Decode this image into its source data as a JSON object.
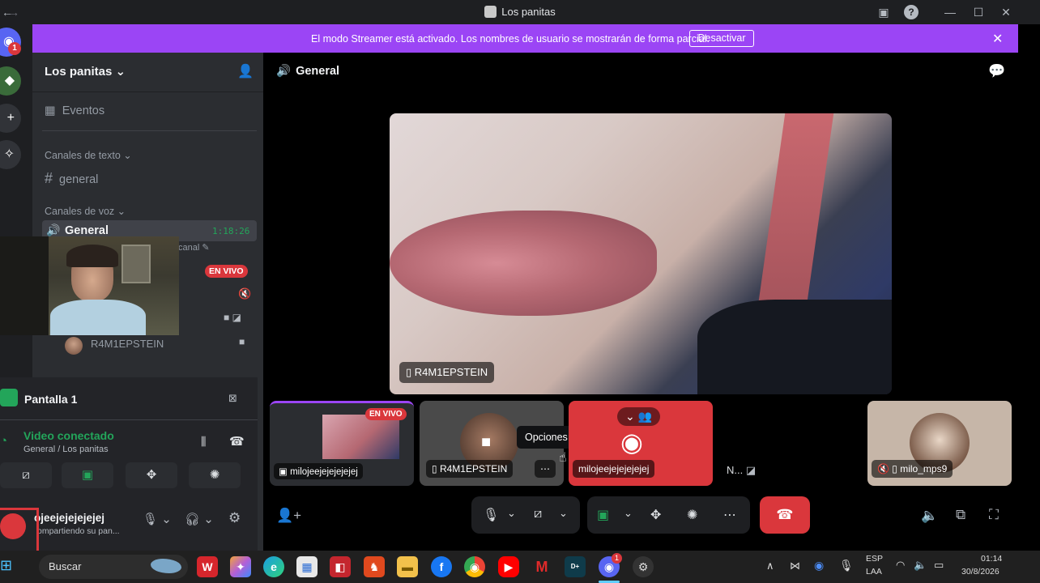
{
  "window": {
    "title": "Los panitas"
  },
  "banner": {
    "message": "El modo Streamer está activado. Los nombres de usuario se mostrarán de forma parcial.",
    "button": "Desactivar"
  },
  "rail": {
    "badge": "1"
  },
  "sidebar": {
    "server_name": "Los panitas",
    "events": "Eventos",
    "text_category": "Canales de texto",
    "text_channel": "general",
    "voice_category": "Canales de voz",
    "voice_channel": "General",
    "voice_timer": "1:18:26",
    "canal_hint": "canal",
    "live": "EN VIVO",
    "user": "R4M1EPSTEIN"
  },
  "voice_panel": {
    "screen": "Pantalla 1",
    "status": "Video conectado",
    "location": "General / Los panitas",
    "username": "ojeejejejejejej",
    "subtext": "ompartiendo su pan..."
  },
  "main": {
    "channel": "General",
    "big_tag": "R4M1EPSTEIN",
    "tiles": [
      {
        "label": "milojeejejejejejej",
        "live": "EN VIVO"
      },
      {
        "label": "R4M1EPSTEIN"
      },
      {
        "label": "milojeejejejejejej"
      },
      {
        "label": "N..."
      },
      {
        "label": "milo_mps9"
      }
    ],
    "tooltip": "Opciones"
  },
  "taskbar": {
    "search": "Buscar",
    "lang1": "ESP",
    "lang2": "LAA",
    "time": "01:14",
    "date": "30/8/2026",
    "discord_badge": "1"
  },
  "colors": {
    "accent": "#9b45f5",
    "danger": "#da373c",
    "online": "#23a55a"
  }
}
